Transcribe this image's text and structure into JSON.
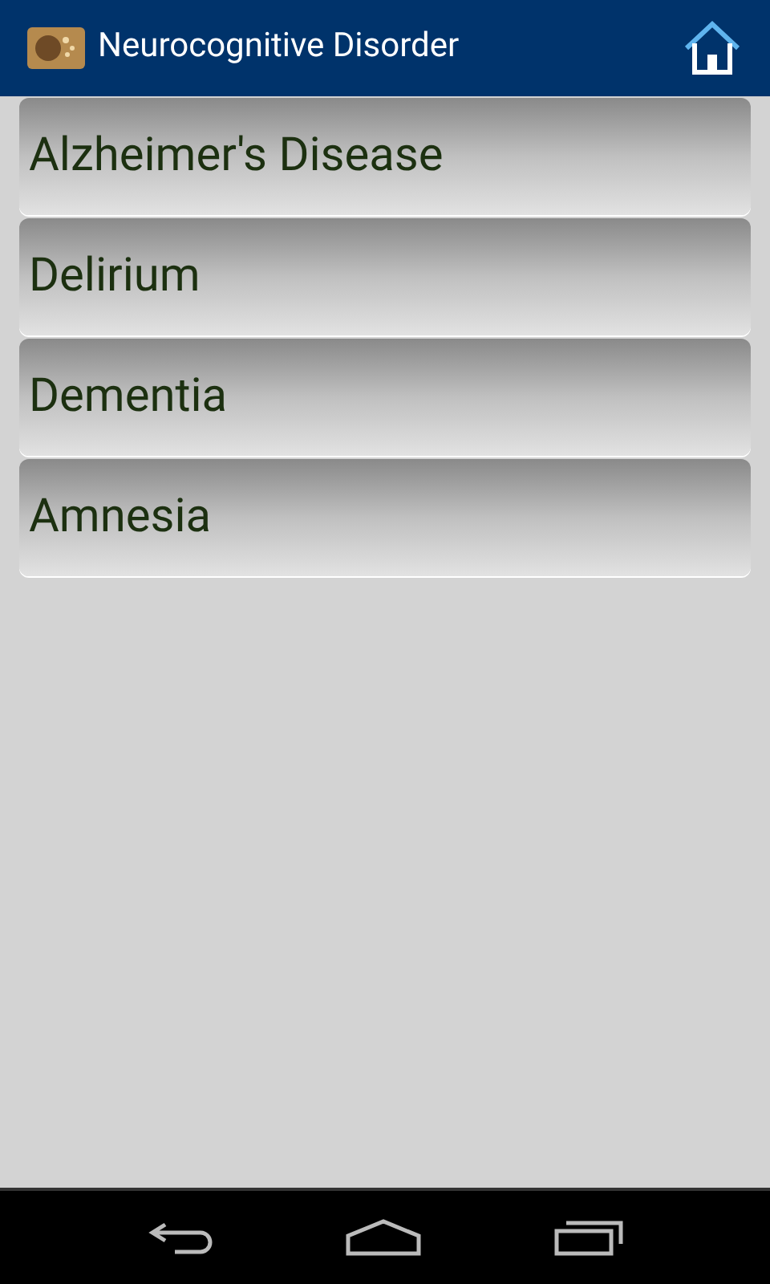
{
  "action_bar": {
    "title": "Neurocognitive Disorder"
  },
  "items": [
    {
      "label": "Alzheimer's Disease"
    },
    {
      "label": "Delirium"
    },
    {
      "label": "Dementia"
    },
    {
      "label": "Amnesia"
    }
  ]
}
